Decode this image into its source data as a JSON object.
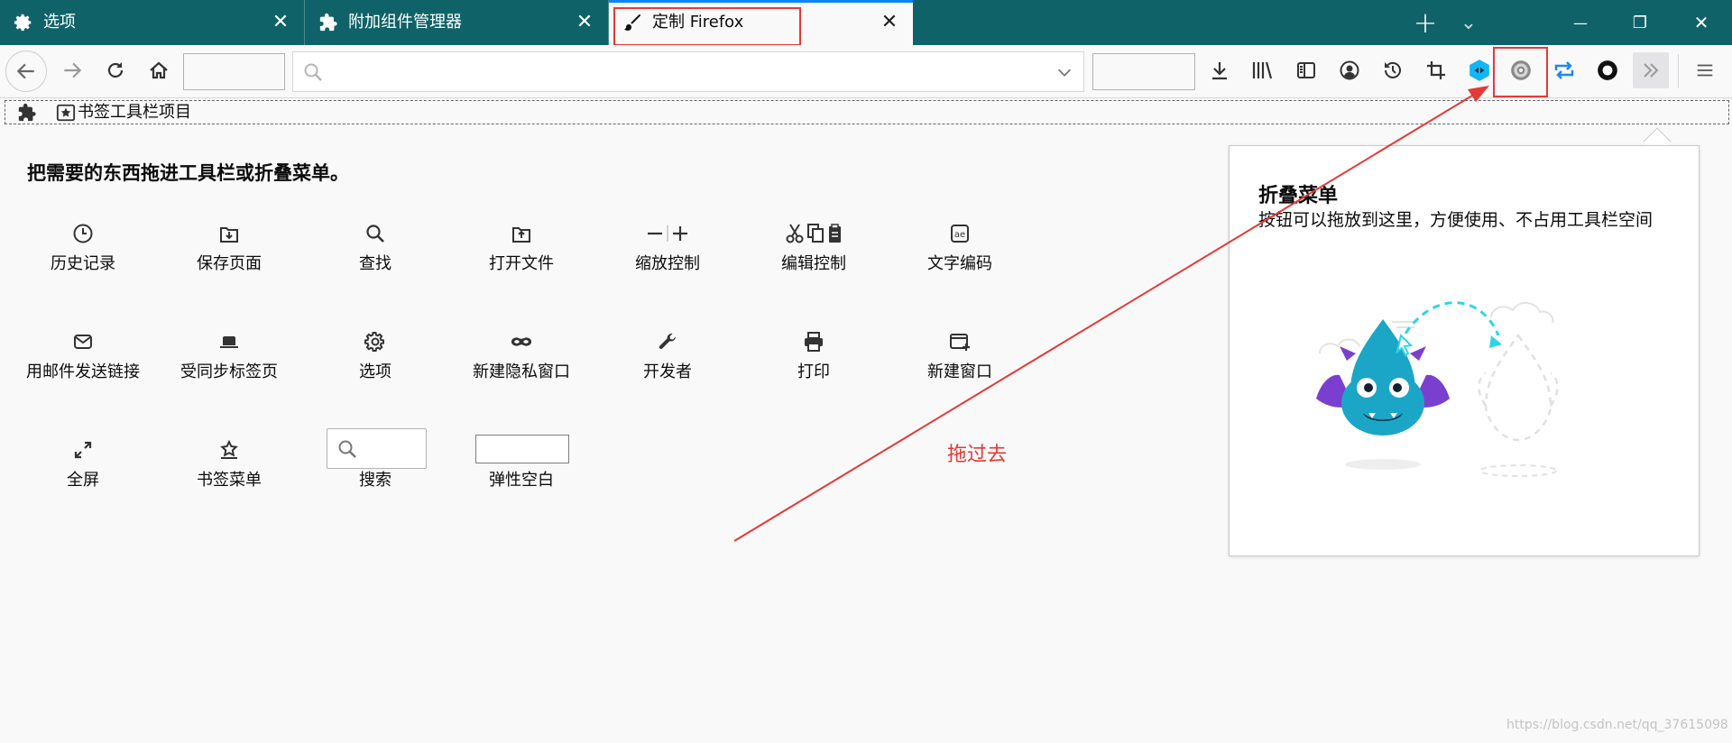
{
  "tabs": [
    {
      "label": "选项",
      "icon": "gear-icon"
    },
    {
      "label": "附加组件管理器",
      "icon": "puzzle-icon"
    },
    {
      "label": "定制 Firefox",
      "icon": "brush-icon"
    }
  ],
  "window_controls": {
    "new_tab": "+",
    "list_tabs": "⌄",
    "minimize": "—",
    "restore": "❐",
    "close": "✕"
  },
  "toolbar_icons": [
    "download-icon",
    "library-icon",
    "sidebar-icon",
    "account-icon",
    "history-icon",
    "screenshot-icon",
    "extension-blue-icon",
    "extension-gear-icon",
    "sync-arrows-icon",
    "circle-icon",
    "overflow-chevron-icon",
    "menu-icon"
  ],
  "bookmarks_toolbar": {
    "label": "书签工具栏项目"
  },
  "palette": {
    "title": "把需要的东西拖进工具栏或折叠菜单。",
    "items": [
      {
        "label": "历史记录",
        "icon": "clock-icon"
      },
      {
        "label": "保存页面",
        "icon": "save-page-icon"
      },
      {
        "label": "查找",
        "icon": "search-icon"
      },
      {
        "label": "打开文件",
        "icon": "open-file-icon"
      },
      {
        "label": "缩放控制",
        "icon": "zoom-icon"
      },
      {
        "label": "编辑控制",
        "icon": "edit-icon"
      },
      {
        "label": "文字编码",
        "icon": "encoding-icon"
      },
      {
        "label": "用邮件发送链接",
        "icon": "mail-icon"
      },
      {
        "label": "受同步标签页",
        "icon": "synced-tabs-icon"
      },
      {
        "label": "选项",
        "icon": "gear-icon"
      },
      {
        "label": "新建隐私窗口",
        "icon": "private-mask-icon"
      },
      {
        "label": "开发者",
        "icon": "wrench-icon"
      },
      {
        "label": "打印",
        "icon": "printer-icon"
      },
      {
        "label": "新建窗口",
        "icon": "new-window-icon"
      },
      {
        "label": "全屏",
        "icon": "fullscreen-icon"
      },
      {
        "label": "书签菜单",
        "icon": "bookmark-star-icon"
      },
      {
        "label": "搜索",
        "icon": "search-box-icon"
      },
      {
        "label": "弹性空白",
        "icon": "flexible-space-icon"
      }
    ]
  },
  "annotation": "拖过去",
  "overflow_panel": {
    "title": "折叠菜单",
    "description": "按钮可以拖放到这里，方便使用、不占用工具栏空间"
  },
  "watermark": "https://blog.csdn.net/qq_37615098",
  "colors": {
    "tabbar": "#0f6368",
    "accent": "#0a84ff",
    "highlight": "#e53935"
  }
}
